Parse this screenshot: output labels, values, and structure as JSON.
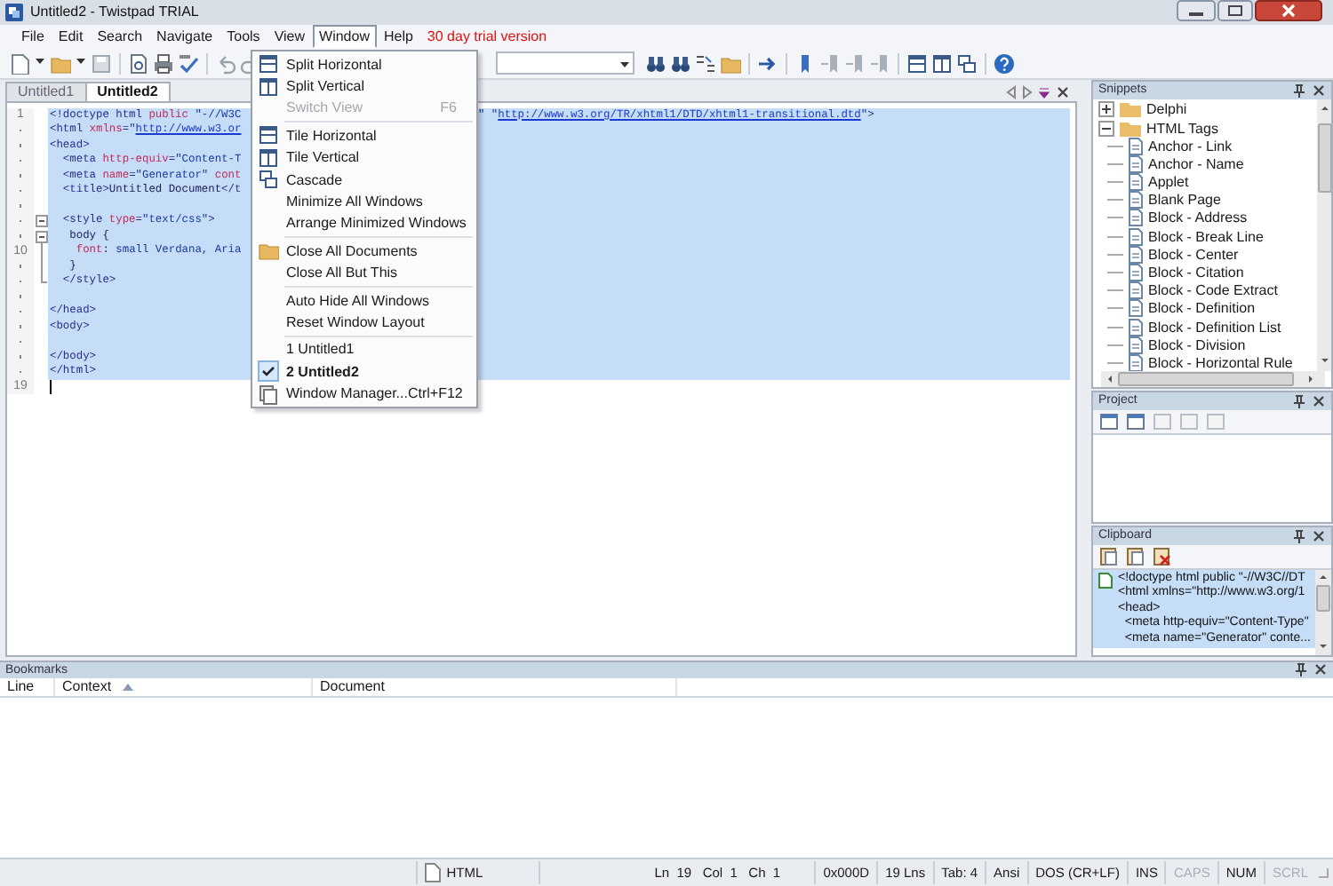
{
  "window": {
    "title": "Untitled2 - Twistpad TRIAL"
  },
  "menu_bar": {
    "items": [
      {
        "label": "File",
        "selected": false
      },
      {
        "label": "Edit",
        "selected": false
      },
      {
        "label": "Search",
        "selected": false
      },
      {
        "label": "Navigate",
        "selected": false
      },
      {
        "label": "Tools",
        "selected": false
      },
      {
        "label": "View",
        "selected": false
      },
      {
        "label": "Window",
        "selected": true
      },
      {
        "label": "Help",
        "selected": false
      }
    ],
    "notice": "30 day trial version"
  },
  "tabs": [
    {
      "label": "Untitled1",
      "selected": false
    },
    {
      "label": "Untitled2",
      "selected": true
    }
  ],
  "editor": {
    "lines": [
      {
        "number": "1",
        "selected": true,
        "tokens": [
          {
            "kind": "tag",
            "text": "<!doctype html "
          },
          {
            "kind": "attr",
            "text": "public "
          },
          {
            "kind": "string",
            "text": "\"-//W3C"
          }
        ],
        "tail": [
          {
            "kind": "string",
            "text": "\" \""
          },
          {
            "kind": "url",
            "text": "http://www.w3.org/TR/xhtml1/DTD/xhtml1-transitional.dtd"
          },
          {
            "kind": "string",
            "text": "\""
          },
          {
            "kind": "tag",
            "text": ">"
          }
        ]
      },
      {
        "selected": true,
        "tokens": [
          {
            "kind": "tag",
            "text": "<html "
          },
          {
            "kind": "attr",
            "text": "xmlns"
          },
          {
            "kind": "tag",
            "text": "="
          },
          {
            "kind": "string",
            "text": "\""
          },
          {
            "kind": "url",
            "text": "http://www.w3.or"
          }
        ]
      },
      {
        "selected": true,
        "tokens": [
          {
            "kind": "tag",
            "text": "<head>"
          }
        ]
      },
      {
        "selected": true,
        "tokens": [
          {
            "kind": "tag",
            "text": "  <meta "
          },
          {
            "kind": "attr",
            "text": "http-equiv"
          },
          {
            "kind": "tag",
            "text": "="
          },
          {
            "kind": "string",
            "text": "\"Content-T"
          }
        ]
      },
      {
        "selected": true,
        "tokens": [
          {
            "kind": "tag",
            "text": "  <meta "
          },
          {
            "kind": "attr",
            "text": "name"
          },
          {
            "kind": "tag",
            "text": "="
          },
          {
            "kind": "string",
            "text": "\"Generator\" "
          },
          {
            "kind": "attr",
            "text": "cont"
          }
        ]
      },
      {
        "selected": true,
        "tokens": [
          {
            "kind": "tag",
            "text": "  <title>"
          },
          {
            "kind": "text",
            "text": "Untitled Document"
          },
          {
            "kind": "tag",
            "text": "</t"
          }
        ]
      },
      {
        "selected": true
      },
      {
        "selected": true,
        "fold_marker": true,
        "tokens": [
          {
            "kind": "tag",
            "text": "  <style "
          },
          {
            "kind": "attr",
            "text": "type"
          },
          {
            "kind": "tag",
            "text": "="
          },
          {
            "kind": "string",
            "text": "\"text/css\""
          },
          {
            "kind": "tag",
            "text": ">"
          }
        ]
      },
      {
        "selected": true,
        "fold_marker": true,
        "tokens": [
          {
            "kind": "text",
            "text": "   body {"
          }
        ]
      },
      {
        "number": "10",
        "selected": true,
        "fold_guide": true,
        "tokens": [
          {
            "kind": "attr",
            "text": "    font"
          },
          {
            "kind": "text",
            "text": ": "
          },
          {
            "kind": "string",
            "text": "small Verdana, Aria"
          }
        ]
      },
      {
        "selected": true,
        "fold_guide": true,
        "tokens": [
          {
            "kind": "text",
            "text": "   }"
          }
        ]
      },
      {
        "selected": true,
        "fold_end": true,
        "tokens": [
          {
            "kind": "tag",
            "text": "  </style>"
          }
        ]
      },
      {
        "selected": true
      },
      {
        "selected": true,
        "tokens": [
          {
            "kind": "tag",
            "text": "</head>"
          }
        ]
      },
      {
        "selected": true,
        "tokens": [
          {
            "kind": "tag",
            "text": "<body>"
          }
        ]
      },
      {
        "selected": true
      },
      {
        "selected": true,
        "tokens": [
          {
            "kind": "tag",
            "text": "</body>"
          }
        ]
      },
      {
        "selected": true,
        "tokens": [
          {
            "kind": "tag",
            "text": "</html>"
          }
        ]
      },
      {
        "number": "19",
        "selected": false,
        "cursor": true
      }
    ]
  },
  "window_menu": {
    "items": [
      {
        "kind": "item",
        "label": "Split Horizontal",
        "disabled": false,
        "checked": false
      },
      {
        "kind": "item",
        "label": "Split Vertical",
        "disabled": false,
        "checked": false
      },
      {
        "kind": "item",
        "label": "Switch View",
        "shortcut": "F6",
        "disabled": true,
        "checked": false
      },
      {
        "kind": "separator"
      },
      {
        "kind": "item",
        "label": "Tile Horizontal",
        "disabled": false,
        "checked": false
      },
      {
        "kind": "item",
        "label": "Tile Vertical",
        "disabled": false,
        "checked": false
      },
      {
        "kind": "item",
        "label": "Cascade",
        "disabled": false,
        "checked": false
      },
      {
        "kind": "item",
        "label": "Minimize All Windows",
        "disabled": false,
        "checked": false
      },
      {
        "kind": "item",
        "label": "Arrange Minimized Windows",
        "disabled": false,
        "checked": false
      },
      {
        "kind": "separator"
      },
      {
        "kind": "item",
        "label": "Close All Documents",
        "disabled": false,
        "checked": false
      },
      {
        "kind": "item",
        "label": "Close All But This",
        "disabled": false,
        "checked": false
      },
      {
        "kind": "separator"
      },
      {
        "kind": "item",
        "label": "Auto Hide All Windows",
        "disabled": false,
        "checked": false
      },
      {
        "kind": "item",
        "label": "Reset Window Layout",
        "disabled": false,
        "checked": false
      },
      {
        "kind": "separator"
      },
      {
        "kind": "item",
        "label": "1 Untitled1",
        "disabled": false,
        "checked": false
      },
      {
        "kind": "item",
        "label": "2 Untitled2",
        "disabled": false,
        "checked": true
      },
      {
        "kind": "item",
        "label": "Window Manager...",
        "shortcut": "Ctrl+F12",
        "disabled": false,
        "checked": false
      }
    ]
  },
  "snippets": {
    "title": "Snippets",
    "tree": [
      {
        "label": "Delphi",
        "kind": "folder",
        "expanded": false,
        "selected": false
      },
      {
        "label": "HTML Tags",
        "kind": "folder",
        "expanded": true,
        "selected": false,
        "children": [
          {
            "label": "Anchor - Link",
            "kind": "snippet"
          },
          {
            "label": "Anchor - Name",
            "kind": "snippet"
          },
          {
            "label": "Applet",
            "kind": "snippet"
          },
          {
            "label": "Blank Page",
            "kind": "snippet"
          },
          {
            "label": "Block - Address",
            "kind": "snippet"
          },
          {
            "label": "Block - Break Line",
            "kind": "snippet"
          },
          {
            "label": "Block - Center",
            "kind": "snippet"
          },
          {
            "label": "Block - Citation",
            "kind": "snippet"
          },
          {
            "label": "Block - Code Extract",
            "kind": "snippet"
          },
          {
            "label": "Block - Definition",
            "kind": "snippet"
          },
          {
            "label": "Block - Definition List",
            "kind": "snippet"
          },
          {
            "label": "Block - Division",
            "kind": "snippet"
          },
          {
            "label": "Block - Horizontal Rule",
            "kind": "snippet"
          }
        ]
      }
    ]
  },
  "project": {
    "title": "Project"
  },
  "clipboard": {
    "title": "Clipboard",
    "entries": [
      {
        "selected": true,
        "lines": [
          "<!doctype html public \"-//W3C//DT",
          "<html xmlns=\"http://www.w3.org/1",
          "<head>",
          "  <meta http-equiv=\"Content-Type\"",
          "  <meta name=\"Generator\" conte..."
        ]
      }
    ]
  },
  "bookmarks": {
    "title": "Bookmarks",
    "columns": [
      {
        "label": "Line"
      },
      {
        "label": "Context",
        "sorted_ascending": true
      },
      {
        "label": "Document"
      }
    ]
  },
  "status_bar": {
    "file_type": "HTML",
    "position": "Ln  19   Col  1   Ch  1",
    "char_code": "0x000D",
    "line_count": "19 Lns",
    "tab": "Tab: 4",
    "encoding": "Ansi",
    "line_ending": "DOS (CR+LF)",
    "indicators": [
      {
        "label": "INS",
        "on": true
      },
      {
        "label": "CAPS",
        "on": false
      },
      {
        "label": "NUM",
        "on": true
      },
      {
        "label": "SCRL",
        "on": false
      }
    ]
  }
}
